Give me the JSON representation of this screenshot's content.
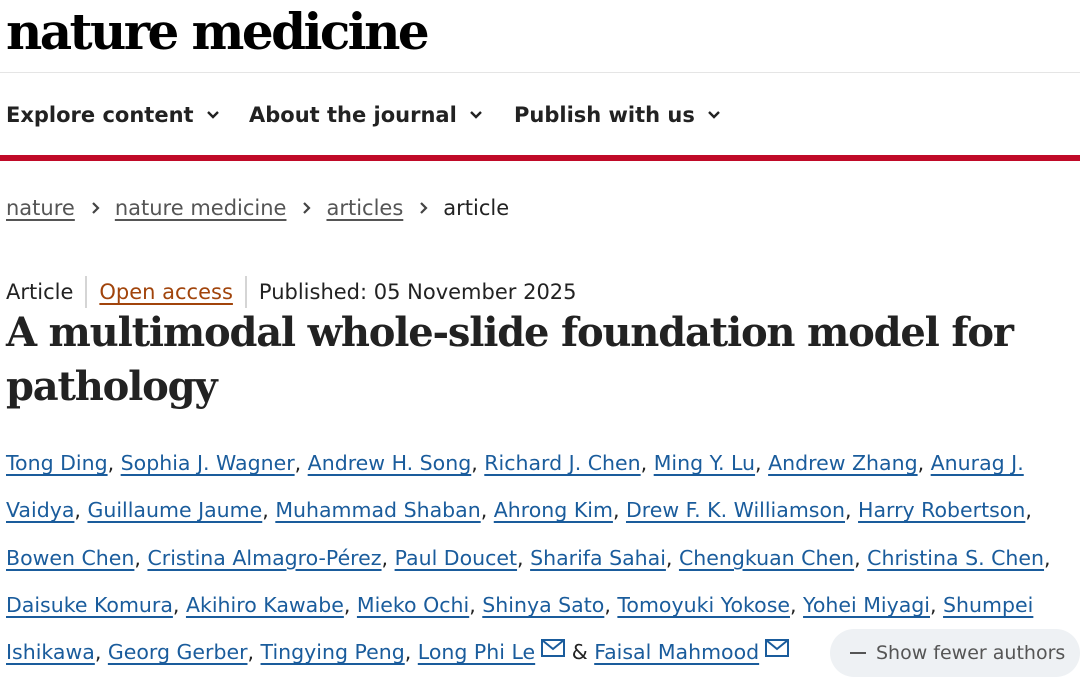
{
  "brand": {
    "logo_text": "nature medicine",
    "accent_color": "#c00a28"
  },
  "nav": {
    "items": [
      {
        "label": "Explore content",
        "icon": "chevron-down-icon"
      },
      {
        "label": "About the journal",
        "icon": "chevron-down-icon"
      },
      {
        "label": "Publish with us",
        "icon": "chevron-down-icon"
      }
    ]
  },
  "breadcrumb": {
    "items": [
      "nature",
      "nature medicine",
      "articles"
    ],
    "current": "article",
    "separator_icon": "chevron-right-icon"
  },
  "article": {
    "type": "Article",
    "access": "Open access",
    "access_color": "#a1440b",
    "published": "Published: 05 November 2025",
    "title": "A multimodal whole-slide foundation model for pathology"
  },
  "authors": {
    "link_color": "#1a5c9c",
    "names": [
      "Tong Ding",
      "Sophia J. Wagner",
      "Andrew H. Song",
      "Richard J. Chen",
      "Ming Y. Lu",
      "Andrew Zhang",
      "Anurag J. Vaidya",
      "Guillaume Jaume",
      "Muhammad Shaban",
      "Ahrong Kim",
      "Drew F. K. Williamson",
      "Harry Robertson",
      "Bowen Chen",
      "Cristina Almagro-Pérez",
      "Paul Doucet",
      "Sharifa Sahai",
      "Chengkuan Chen",
      "Christina S. Chen",
      "Daisuke Komura",
      "Akihiro Kawabe",
      "Mieko Ochi",
      "Shinya Sato",
      "Tomoyuki Yokose",
      "Yohei Miyagi",
      "Shumpei Ishikawa",
      "Georg Gerber",
      "Tingying Peng",
      "Long Phi Le",
      "Faisal Mahmood"
    ],
    "separator": ", ",
    "last_separator": " & ",
    "corresponding_icon": "envelope-icon",
    "show_fewer_label": "Show fewer authors",
    "show_fewer_icon": "minus-icon"
  }
}
